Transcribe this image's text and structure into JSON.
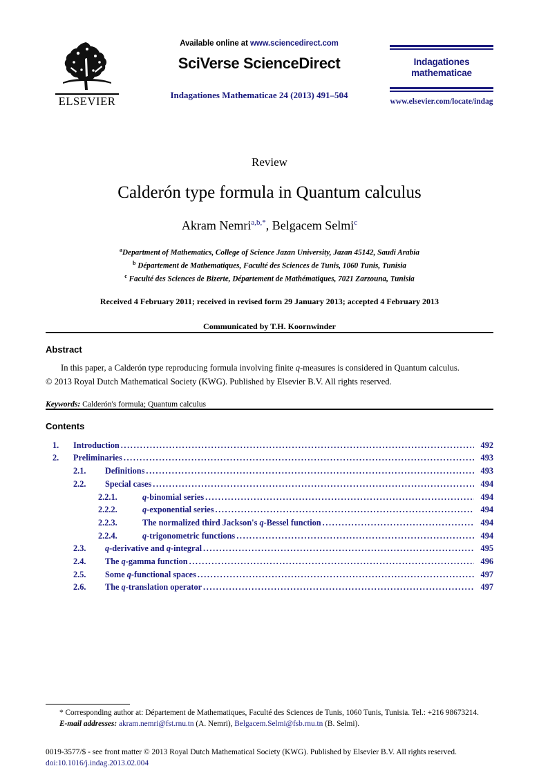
{
  "masthead": {
    "publisher_name": "ELSEVIER",
    "available_prefix": "Available online at ",
    "available_url": "www.sciencedirect.com",
    "sciencedirect_logo": "SciVerse ScienceDirect",
    "journal_reference": "Indagationes Mathematicae 24 (2013) 491–504",
    "journal_logo_line1": "Indagationes",
    "journal_logo_line2": "mathematicae",
    "journal_url": "www.elsevier.com/locate/indag",
    "accent_color": "#1a1a7e"
  },
  "article": {
    "doctype": "Review",
    "title": "Calderón type formula in Quantum calculus",
    "author1_name": "Akram Nemri",
    "author1_marks": "a,b,*",
    "author_separator": ", ",
    "author2_name": "Belgacem Selmi",
    "author2_marks": "c",
    "affiliations": [
      {
        "mark": "a",
        "text": "Department of Mathematics, College of Science Jazan University, Jazan 45142, Saudi Arabia"
      },
      {
        "mark": "b",
        "text": "Département de Mathematiques, Faculté des Sciences de Tunis, 1060 Tunis, Tunisia"
      },
      {
        "mark": "c",
        "text": "Faculté des Sciences de Bizerte, Département de Mathématiques, 7021 Zarzouna, Tunisia"
      }
    ],
    "history": "Received 4 February 2011; received in revised form 29 January 2013; accepted 4 February 2013",
    "communicated": "Communicated by T.H. Koornwinder"
  },
  "abstract": {
    "heading": "Abstract",
    "text_part1": "In this paper, a Calderón type reproducing formula involving finite ",
    "text_italic": "q",
    "text_part2": "-measures is considered in Quantum calculus.",
    "copyright": "© 2013 Royal Dutch Mathematical Society (KWG). Published by Elsevier B.V. All rights reserved.",
    "keywords_label": "Keywords:",
    "keywords_value": "Calderón's formula; Quantum calculus"
  },
  "contents": {
    "heading": "Contents",
    "entries": [
      {
        "level": 1,
        "number": "1.",
        "label": "Introduction",
        "page": "492"
      },
      {
        "level": 1,
        "number": "2.",
        "label": "Preliminaries",
        "page": "493"
      },
      {
        "level": 2,
        "number": "2.1.",
        "label": "Definitions",
        "page": "493"
      },
      {
        "level": 2,
        "number": "2.2.",
        "label": "Special cases",
        "page": "494"
      },
      {
        "level": 3,
        "number": "2.2.1.",
        "label": "q-binomial series",
        "page": "494"
      },
      {
        "level": 3,
        "number": "2.2.2.",
        "label": "q-exponential series",
        "page": "494"
      },
      {
        "level": 3,
        "number": "2.2.3.",
        "label": "The normalized third Jackson's q-Bessel function",
        "page": "494"
      },
      {
        "level": 3,
        "number": "2.2.4.",
        "label": "q-trigonometric functions",
        "page": "494"
      },
      {
        "level": 2,
        "number": "2.3.",
        "label": "q-derivative and q-integral",
        "page": "495"
      },
      {
        "level": 2,
        "number": "2.4.",
        "label": "The q-gamma function",
        "page": "496"
      },
      {
        "level": 2,
        "number": "2.5.",
        "label": "Some q-functional spaces",
        "page": "497"
      },
      {
        "level": 2,
        "number": "2.6.",
        "label": "The q-translation operator",
        "page": "497"
      }
    ]
  },
  "footnotes": {
    "corresponding_star": "*",
    "corresponding_text": " Corresponding author at: Département de Mathematiques, Faculté des Sciences de Tunis, 1060 Tunis, Tunisia. Tel.: +216 98673214.",
    "emails_label": "E-mail addresses:",
    "email1": "akram.nemri@fst.rnu.tn",
    "email1_owner": " (A. Nemri), ",
    "email2": "Belgacem.Selmi@fsb.rnu.tn",
    "email2_owner": " (B. Selmi)."
  },
  "imprint": {
    "issn_line": "0019-3577/$ - see front matter © 2013 Royal Dutch Mathematical Society (KWG). Published by Elsevier B.V. All rights reserved.",
    "doi": "doi:10.1016/j.indag.2013.02.004"
  }
}
